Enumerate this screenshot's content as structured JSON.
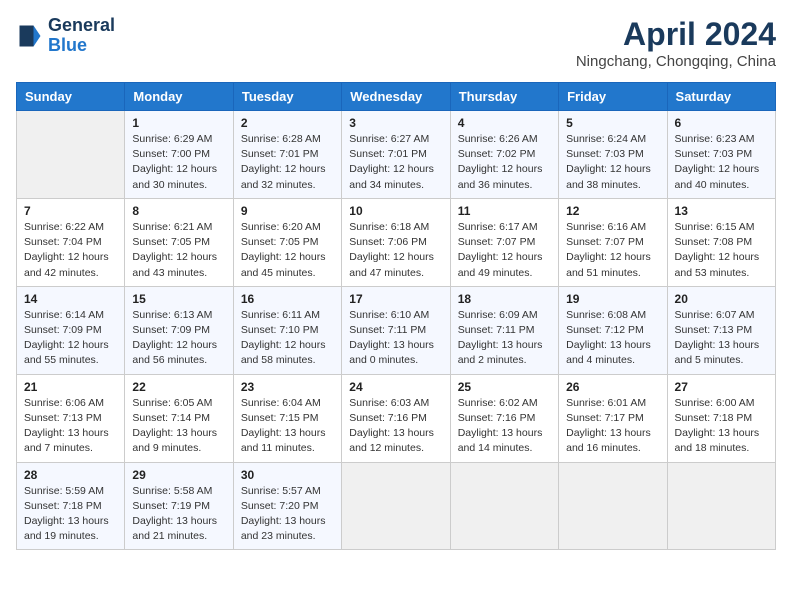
{
  "header": {
    "logo_line1": "General",
    "logo_line2": "Blue",
    "month_title": "April 2024",
    "location": "Ningchang, Chongqing, China"
  },
  "days_of_week": [
    "Sunday",
    "Monday",
    "Tuesday",
    "Wednesday",
    "Thursday",
    "Friday",
    "Saturday"
  ],
  "weeks": [
    [
      {
        "day": "",
        "empty": true
      },
      {
        "day": "1",
        "sunrise": "Sunrise: 6:29 AM",
        "sunset": "Sunset: 7:00 PM",
        "daylight": "Daylight: 12 hours and 30 minutes."
      },
      {
        "day": "2",
        "sunrise": "Sunrise: 6:28 AM",
        "sunset": "Sunset: 7:01 PM",
        "daylight": "Daylight: 12 hours and 32 minutes."
      },
      {
        "day": "3",
        "sunrise": "Sunrise: 6:27 AM",
        "sunset": "Sunset: 7:01 PM",
        "daylight": "Daylight: 12 hours and 34 minutes."
      },
      {
        "day": "4",
        "sunrise": "Sunrise: 6:26 AM",
        "sunset": "Sunset: 7:02 PM",
        "daylight": "Daylight: 12 hours and 36 minutes."
      },
      {
        "day": "5",
        "sunrise": "Sunrise: 6:24 AM",
        "sunset": "Sunset: 7:03 PM",
        "daylight": "Daylight: 12 hours and 38 minutes."
      },
      {
        "day": "6",
        "sunrise": "Sunrise: 6:23 AM",
        "sunset": "Sunset: 7:03 PM",
        "daylight": "Daylight: 12 hours and 40 minutes."
      }
    ],
    [
      {
        "day": "7",
        "sunrise": "Sunrise: 6:22 AM",
        "sunset": "Sunset: 7:04 PM",
        "daylight": "Daylight: 12 hours and 42 minutes."
      },
      {
        "day": "8",
        "sunrise": "Sunrise: 6:21 AM",
        "sunset": "Sunset: 7:05 PM",
        "daylight": "Daylight: 12 hours and 43 minutes."
      },
      {
        "day": "9",
        "sunrise": "Sunrise: 6:20 AM",
        "sunset": "Sunset: 7:05 PM",
        "daylight": "Daylight: 12 hours and 45 minutes."
      },
      {
        "day": "10",
        "sunrise": "Sunrise: 6:18 AM",
        "sunset": "Sunset: 7:06 PM",
        "daylight": "Daylight: 12 hours and 47 minutes."
      },
      {
        "day": "11",
        "sunrise": "Sunrise: 6:17 AM",
        "sunset": "Sunset: 7:07 PM",
        "daylight": "Daylight: 12 hours and 49 minutes."
      },
      {
        "day": "12",
        "sunrise": "Sunrise: 6:16 AM",
        "sunset": "Sunset: 7:07 PM",
        "daylight": "Daylight: 12 hours and 51 minutes."
      },
      {
        "day": "13",
        "sunrise": "Sunrise: 6:15 AM",
        "sunset": "Sunset: 7:08 PM",
        "daylight": "Daylight: 12 hours and 53 minutes."
      }
    ],
    [
      {
        "day": "14",
        "sunrise": "Sunrise: 6:14 AM",
        "sunset": "Sunset: 7:09 PM",
        "daylight": "Daylight: 12 hours and 55 minutes."
      },
      {
        "day": "15",
        "sunrise": "Sunrise: 6:13 AM",
        "sunset": "Sunset: 7:09 PM",
        "daylight": "Daylight: 12 hours and 56 minutes."
      },
      {
        "day": "16",
        "sunrise": "Sunrise: 6:11 AM",
        "sunset": "Sunset: 7:10 PM",
        "daylight": "Daylight: 12 hours and 58 minutes."
      },
      {
        "day": "17",
        "sunrise": "Sunrise: 6:10 AM",
        "sunset": "Sunset: 7:11 PM",
        "daylight": "Daylight: 13 hours and 0 minutes."
      },
      {
        "day": "18",
        "sunrise": "Sunrise: 6:09 AM",
        "sunset": "Sunset: 7:11 PM",
        "daylight": "Daylight: 13 hours and 2 minutes."
      },
      {
        "day": "19",
        "sunrise": "Sunrise: 6:08 AM",
        "sunset": "Sunset: 7:12 PM",
        "daylight": "Daylight: 13 hours and 4 minutes."
      },
      {
        "day": "20",
        "sunrise": "Sunrise: 6:07 AM",
        "sunset": "Sunset: 7:13 PM",
        "daylight": "Daylight: 13 hours and 5 minutes."
      }
    ],
    [
      {
        "day": "21",
        "sunrise": "Sunrise: 6:06 AM",
        "sunset": "Sunset: 7:13 PM",
        "daylight": "Daylight: 13 hours and 7 minutes."
      },
      {
        "day": "22",
        "sunrise": "Sunrise: 6:05 AM",
        "sunset": "Sunset: 7:14 PM",
        "daylight": "Daylight: 13 hours and 9 minutes."
      },
      {
        "day": "23",
        "sunrise": "Sunrise: 6:04 AM",
        "sunset": "Sunset: 7:15 PM",
        "daylight": "Daylight: 13 hours and 11 minutes."
      },
      {
        "day": "24",
        "sunrise": "Sunrise: 6:03 AM",
        "sunset": "Sunset: 7:16 PM",
        "daylight": "Daylight: 13 hours and 12 minutes."
      },
      {
        "day": "25",
        "sunrise": "Sunrise: 6:02 AM",
        "sunset": "Sunset: 7:16 PM",
        "daylight": "Daylight: 13 hours and 14 minutes."
      },
      {
        "day": "26",
        "sunrise": "Sunrise: 6:01 AM",
        "sunset": "Sunset: 7:17 PM",
        "daylight": "Daylight: 13 hours and 16 minutes."
      },
      {
        "day": "27",
        "sunrise": "Sunrise: 6:00 AM",
        "sunset": "Sunset: 7:18 PM",
        "daylight": "Daylight: 13 hours and 18 minutes."
      }
    ],
    [
      {
        "day": "28",
        "sunrise": "Sunrise: 5:59 AM",
        "sunset": "Sunset: 7:18 PM",
        "daylight": "Daylight: 13 hours and 19 minutes."
      },
      {
        "day": "29",
        "sunrise": "Sunrise: 5:58 AM",
        "sunset": "Sunset: 7:19 PM",
        "daylight": "Daylight: 13 hours and 21 minutes."
      },
      {
        "day": "30",
        "sunrise": "Sunrise: 5:57 AM",
        "sunset": "Sunset: 7:20 PM",
        "daylight": "Daylight: 13 hours and 23 minutes."
      },
      {
        "day": "",
        "empty": true
      },
      {
        "day": "",
        "empty": true
      },
      {
        "day": "",
        "empty": true
      },
      {
        "day": "",
        "empty": true
      }
    ]
  ]
}
